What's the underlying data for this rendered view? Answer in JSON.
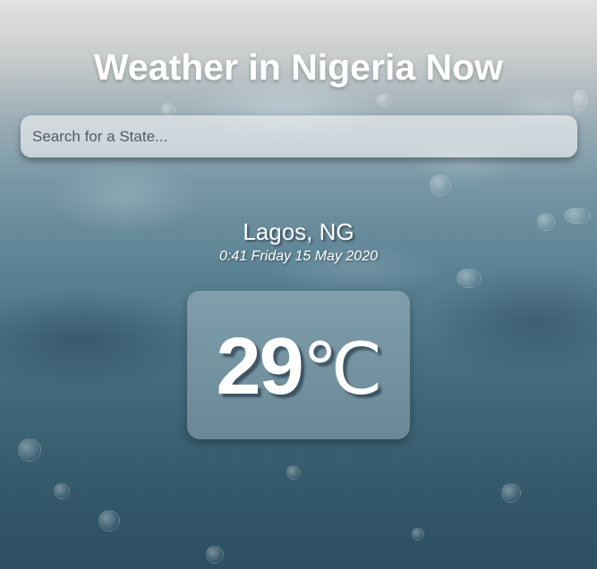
{
  "header": {
    "title": "Weather in Nigeria Now"
  },
  "search": {
    "placeholder": "Search for a State...",
    "value": ""
  },
  "location": {
    "city": "Lagos, NG",
    "datetime": "0:41 Friday 15 May 2020"
  },
  "weather": {
    "temperature": "29",
    "unit": "℃"
  }
}
